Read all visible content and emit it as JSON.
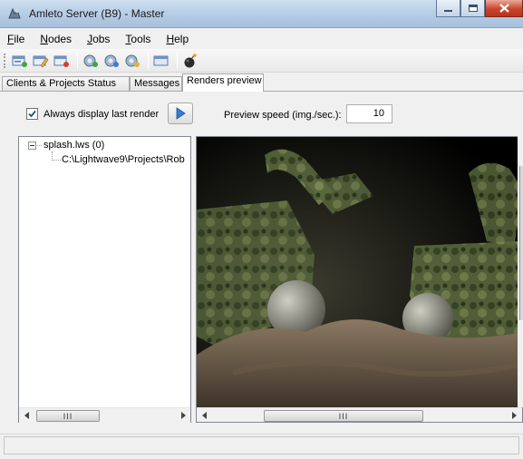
{
  "window": {
    "title": "Amleto Server (B9) - Master"
  },
  "menu": {
    "items": [
      {
        "accel": "F",
        "rest": "ile"
      },
      {
        "accel": "N",
        "rest": "odes"
      },
      {
        "accel": "J",
        "rest": "obs"
      },
      {
        "accel": "T",
        "rest": "ools"
      },
      {
        "accel": "H",
        "rest": "elp"
      }
    ]
  },
  "tabs": [
    {
      "label": "Clients & Projects Status"
    },
    {
      "label": "Messages"
    },
    {
      "label": "Renders preview"
    }
  ],
  "renders": {
    "always_display_label": "Always display last render",
    "always_display_checked": true,
    "speed_label": "Preview speed (img./sec.):",
    "speed_value": "10"
  },
  "tree": {
    "root_label": "splash.lws (0)",
    "child_label": "C:\\Lightwave9\\Projects\\Rob"
  },
  "scroll": {
    "thumb_grip": "III"
  },
  "colors": {
    "accent": "#3a7bd5",
    "close": "#c9452b"
  }
}
